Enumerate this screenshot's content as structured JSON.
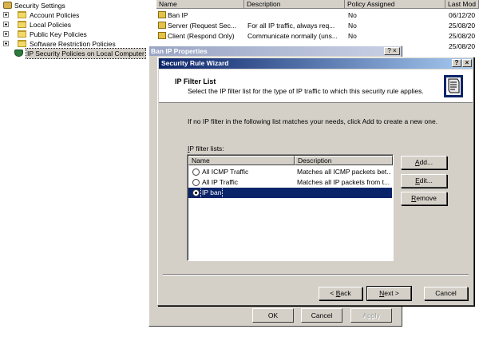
{
  "tree": {
    "items": [
      {
        "label": "Security Settings",
        "icon": "security-settings-icon",
        "level": 0
      },
      {
        "label": "Account Policies",
        "icon": "folder-icon",
        "level": 1,
        "expandable": true
      },
      {
        "label": "Local Policies",
        "icon": "folder-icon",
        "level": 1,
        "expandable": true
      },
      {
        "label": "Public Key Policies",
        "icon": "folder-icon",
        "level": 1,
        "expandable": true
      },
      {
        "label": "Software Restriction Policies",
        "icon": "folder-icon",
        "level": 1,
        "expandable": true
      },
      {
        "label": "IP Security Policies on Local Computer",
        "icon": "ip-security-icon",
        "level": 1,
        "selected": true
      }
    ]
  },
  "listview": {
    "columns": [
      "Name",
      "Description",
      "Policy Assigned",
      "Last Mod"
    ],
    "rows": [
      {
        "name": "Ban IP",
        "description": "",
        "assigned": "No",
        "modified": "06/12/20"
      },
      {
        "name": "Server (Request Sec...",
        "description": "For all IP traffic, always req...",
        "assigned": "No",
        "modified": "25/08/20"
      },
      {
        "name": "Client (Respond Only)",
        "description": "Communicate normally (uns...",
        "assigned": "No",
        "modified": "25/08/20"
      },
      {
        "name": "",
        "description": "",
        "assigned": "",
        "modified": "25/08/20"
      }
    ]
  },
  "properties_dialog": {
    "title": "Ban IP Properties",
    "help": "?",
    "close": "×",
    "ok": "OK",
    "cancel": "Cancel",
    "apply": "Apply"
  },
  "wizard": {
    "title": "Security Rule Wizard",
    "help": "?",
    "close": "×",
    "header_title": "IP Filter List",
    "header_subtitle": "Select the IP filter list for the type of IP traffic to which this security rule applies.",
    "instruction": "If no IP filter in the following list matches your needs, click Add to create a new one.",
    "filter_lists_label_prefix": "I",
    "filter_lists_label_rest": "P filter lists:",
    "list_columns": [
      "Name",
      "Description"
    ],
    "filters": [
      {
        "name": "All ICMP Traffic",
        "description": "Matches all ICMP packets bet...",
        "selected": false
      },
      {
        "name": "All IP Traffic",
        "description": "Matches all IP packets from t...",
        "selected": false
      },
      {
        "name": "IP ban",
        "description": "",
        "selected": true
      }
    ],
    "add": {
      "mnemonic": "A",
      "rest": "dd..."
    },
    "edit": {
      "mnemonic": "E",
      "rest": "dit..."
    },
    "remove": {
      "mnemonic": "R",
      "rest": "emove"
    },
    "back": {
      "prefix": "< ",
      "mnemonic": "B",
      "rest": "ack"
    },
    "next": {
      "mnemonic": "N",
      "rest": "ext >"
    },
    "cancel": "Cancel"
  },
  "colors": {
    "title_active_start": "#0a246a",
    "title_active_end": "#a6caf0",
    "face": "#d4d0c8",
    "selection": "#0a246a"
  }
}
